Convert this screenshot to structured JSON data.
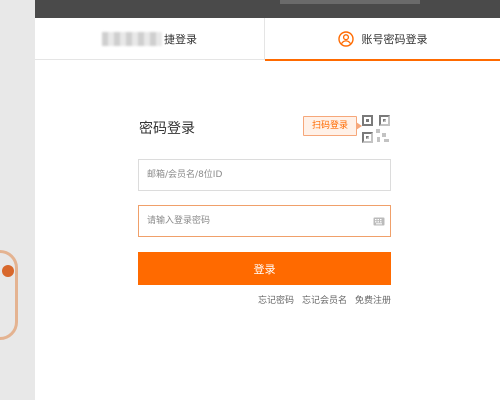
{
  "tabs": {
    "quick_login_label": "捷登录",
    "account_login_label": "账号密码登录"
  },
  "form": {
    "title": "密码登录",
    "scan_tip": "扫码登录",
    "username_placeholder": "邮箱/会员名/8位ID",
    "password_placeholder": "请输入登录密码",
    "login_button": "登录"
  },
  "links": {
    "forgot_password": "忘记密码",
    "forgot_member_name": "忘记会员名",
    "register": "免费注册"
  },
  "colors": {
    "accent": "#ff6a00",
    "tip_bg": "#fff1e8",
    "tip_border": "#f6a77a"
  },
  "icons": {
    "tab_right": "user-circle-icon",
    "qr": "qr-code-icon",
    "keyboard": "keyboard-icon"
  }
}
